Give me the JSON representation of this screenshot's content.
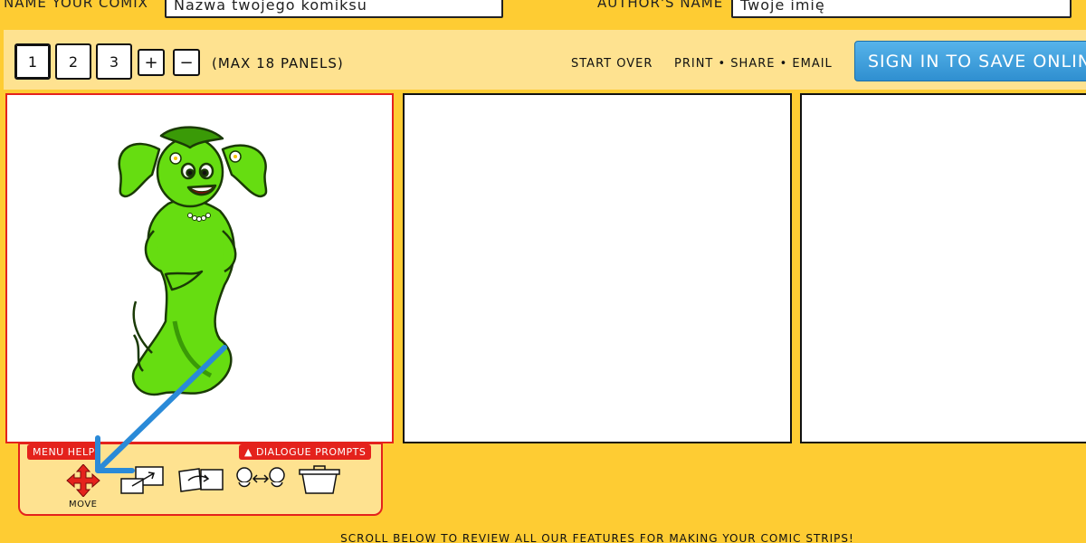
{
  "header": {
    "comix_label": "NAME YOUR COMIX",
    "comix_value": "Nazwa twojego komiksu",
    "author_label": "AUTHOR'S NAME",
    "author_value": "Twoje imię"
  },
  "panel_controls": {
    "panels": [
      "1",
      "2",
      "3"
    ],
    "add_label": "+",
    "remove_label": "−",
    "max_text": "(MAX 18 PANELS)"
  },
  "actions": {
    "start_over": "START OVER",
    "print_share_email": "PRINT • SHARE • EMAIL",
    "sign_in": "SIGN IN TO SAVE ONLINE"
  },
  "menu": {
    "menu_help": "MENU HELP",
    "dialogue_prompts": "▲ DIALOGUE PROMPTS",
    "move_label": "MOVE",
    "tools": [
      "move-icon",
      "resize-icon",
      "flip-icon",
      "swap-characters-icon",
      "trash-icon"
    ]
  },
  "footer": {
    "text": "SCROLL BELOW TO REVIEW ALL OUR FEATURES FOR MAKING YOUR COMIC STRIPS!"
  },
  "colors": {
    "background": "#fecc33",
    "toolbar": "#fee290",
    "accent_red": "#e4221c",
    "sign_in_blue": "#2f8fd0",
    "character_green": "#66dd11",
    "arrow_blue": "#2a8ad8"
  }
}
